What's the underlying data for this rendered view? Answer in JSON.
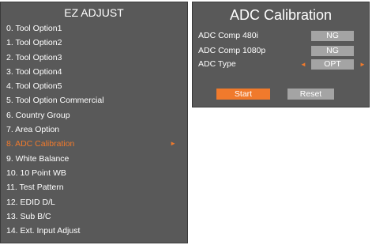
{
  "menu": {
    "title": "EZ ADJUST",
    "items": [
      {
        "label": "0. Tool Option1"
      },
      {
        "label": "1. Tool Option2"
      },
      {
        "label": "2. Tool Option3"
      },
      {
        "label": "3. Tool Option4"
      },
      {
        "label": "4. Tool Option5"
      },
      {
        "label": "5. Tool Option Commercial"
      },
      {
        "label": "6. Country Group"
      },
      {
        "label": "7. Area Option"
      },
      {
        "label": "8. ADC Calibration",
        "active": true,
        "arrow": "►"
      },
      {
        "label": "9. White Balance"
      },
      {
        "label": "10. 10 Point WB"
      },
      {
        "label": "11. Test Pattern"
      },
      {
        "label": "12. EDID D/L"
      },
      {
        "label": "13. Sub B/C"
      },
      {
        "label": "14. Ext. Input Adjust"
      }
    ]
  },
  "adc": {
    "title": "ADC Calibration",
    "rows": [
      {
        "label": "ADC Comp 480i",
        "value": "NG"
      },
      {
        "label": "ADC Comp 1080p",
        "value": "NG"
      },
      {
        "label": "ADC Type",
        "value": "OPT",
        "left_arrow": "◄",
        "right_arrow": "►"
      }
    ],
    "start_label": "Start",
    "reset_label": "Reset"
  },
  "colors": {
    "panel": "#595959",
    "accent": "#f07a2c",
    "value_box": "#a4a4a4",
    "text": "#ffffff"
  }
}
